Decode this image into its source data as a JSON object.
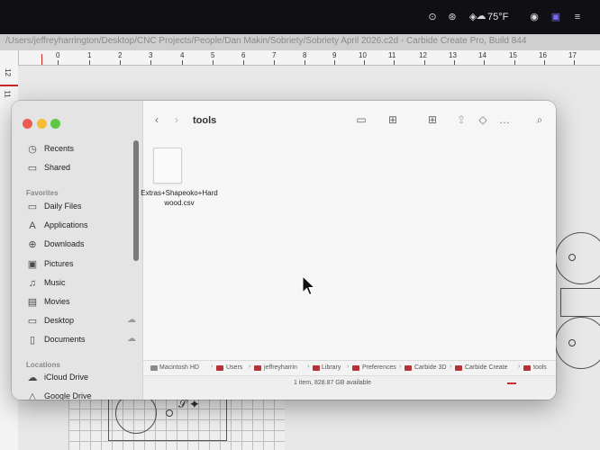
{
  "menubar": {
    "weather": "75°F",
    "icons": [
      "focus-icon",
      "creative-cloud-icon",
      "dropbox-icon",
      "weather-cloud-icon",
      "media-icon",
      "screen-mirror-icon",
      "dropdown-icon"
    ]
  },
  "app": {
    "title_path": "/Users/jeffreyharrington/Desktop/CNC Projects/People/Dan Makin/Sobriety/Sobriety April 2026.c2d - Carbide Create Pro, Build 844"
  },
  "ruler": {
    "h_labels": [
      "0",
      "1",
      "2",
      "3",
      "4",
      "5",
      "6",
      "7",
      "8",
      "9",
      "10",
      "11",
      "12",
      "13",
      "14",
      "15",
      "16",
      "17"
    ],
    "v_labels": [
      "12",
      "11"
    ]
  },
  "finder": {
    "title": "tools",
    "sidebar": {
      "items_top": [
        {
          "icon": "clock-icon",
          "label": "Recents"
        },
        {
          "icon": "shared-folder-icon",
          "label": "Shared"
        }
      ],
      "favorites_label": "Favorites",
      "favorites": [
        {
          "icon": "folder-icon",
          "label": "Daily Files"
        },
        {
          "icon": "applications-icon",
          "label": "Applications"
        },
        {
          "icon": "downloads-icon",
          "label": "Downloads"
        },
        {
          "icon": "pictures-icon",
          "label": "Pictures"
        },
        {
          "icon": "music-icon",
          "label": "Music"
        },
        {
          "icon": "movies-icon",
          "label": "Movies"
        },
        {
          "icon": "desktop-icon",
          "label": "Desktop"
        },
        {
          "icon": "documents-icon",
          "label": "Documents"
        }
      ],
      "locations_label": "Locations",
      "locations": [
        {
          "icon": "icloud-icon",
          "label": "iCloud Drive"
        },
        {
          "icon": "drive-icon",
          "label": "Google Drive"
        }
      ]
    },
    "file": {
      "name": "Extras+Shapeoko+Hardwood.csv"
    },
    "path": [
      "Macintosh HD",
      "Users",
      "jeffreyharrin",
      "Library",
      "Preferences",
      "Carbide 3D",
      "Carbide Create",
      "tools"
    ],
    "status": "1 item, 828.87 GB available"
  },
  "colors": {
    "menubar_bg": "#101014",
    "folder_red": "#b5323a",
    "close": "#ee5b55",
    "minimize": "#f5bd33",
    "zoom": "#5ec744"
  }
}
